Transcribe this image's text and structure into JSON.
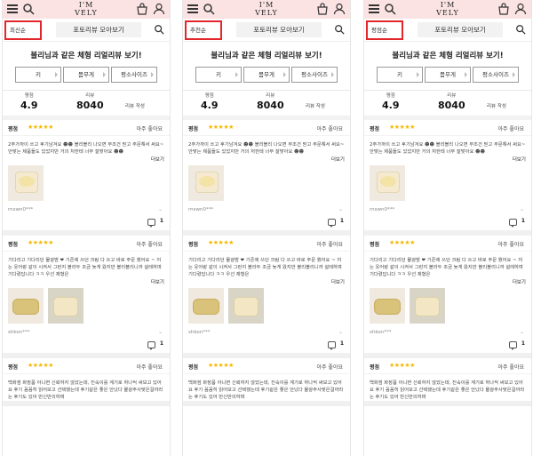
{
  "panels": [
    {
      "logo_line1": "I'M",
      "logo_line2": "VELY",
      "sort_label": "최신순",
      "photo_review_label": "포토리뷰 모아보기",
      "headline": "블리님과 같은 체형 리얼리뷰 보기!",
      "options": [
        "키",
        "몸무게",
        "평소사이즈"
      ],
      "stats": {
        "rating_label": "평점",
        "rating_value": "4.9",
        "review_label": "리뷰",
        "review_value": "8040",
        "write_label": "리뷰 작성"
      },
      "reviews": [
        {
          "label": "평점",
          "stars": "★★★★★",
          "like": "아주 좋아요",
          "text": "2주가까이 쓰고 후기남겨요 ☻☻ 블리블리 나오면 무조건 믿고 주문해서 써요~ 안맞는 제품들도 있었지만 거의 처한테 너무 잘맞아요 ☻☻",
          "more": "더보기",
          "author": "rnswn0***",
          "comments": "1"
        },
        {
          "label": "평점",
          "stars": "★★★★★",
          "like": "아주 좋아요",
          "text": "기다리고 기다리던 물광밤 ❤ 기존에 쓰던 크림 다 쓰고 바로 주문 했어요 ~ 저는 웃어랑 같이 시켜서 그런지 블라두 조금 늦게 왔지만 블리블리니까 설레하며 기다렸답니다 ㅋㅋ 우선 제형은",
          "more": "더보기",
          "author": "shkon***",
          "comments": "1"
        },
        {
          "label": "평점",
          "stars": "★★★★★",
          "like": "아주 좋아요",
          "text": "백화점 화장품 아니면 신뢰하지 않았는데, 진숙이를 계기로 하나씩 써보고 있어요 후기 꼼꼼히 읽어보고 선택했는데 후기같은 좋은 안났다 물광주사맞은걸까라는 후기도 있어 반신반의하며"
        }
      ]
    },
    {
      "logo_line1": "I'M",
      "logo_line2": "VELY",
      "sort_label": "추천순",
      "photo_review_label": "포토리뷰 모아보기",
      "headline": "블리님과 같은 체형 리얼리뷰 보기!",
      "options": [
        "키",
        "몸무게",
        "평소사이즈"
      ],
      "stats": {
        "rating_label": "평점",
        "rating_value": "4.9",
        "review_label": "리뷰",
        "review_value": "8040",
        "write_label": "리뷰 작성"
      },
      "reviews": [
        {
          "label": "평점",
          "stars": "★★★★★",
          "like": "아주 좋아요",
          "text": "2주가까이 쓰고 후기남겨요 ☻☻ 블리블리 나오면 무조건 믿고 주문해서 써요~ 안맞는 제품들도 있었지만 거의 처한테 너무 잘맞아요 ☻☻",
          "more": "더보기",
          "author": "rnswn0***",
          "comments": "1"
        },
        {
          "label": "평점",
          "stars": "★★★★★",
          "like": "아주 좋아요",
          "text": "기다리고 기다리던 물광밤 ❤ 기존에 쓰던 크림 다 쓰고 바로 주문 했어요 ~ 저는 웃어랑 같이 시켜서 그런지 블라두 조금 늦게 왔지만 블리블리니까 설레하며 기다렸답니다 ㅋㅋ 우선 제형은",
          "more": "더보기",
          "author": "shkon***",
          "comments": "1"
        },
        {
          "label": "평점",
          "stars": "★★★★★",
          "like": "아주 좋아요",
          "text": "백화점 화장품 아니면 신뢰하지 않았는데, 진숙이를 계기로 하나씩 써보고 있어요 후기 꼼꼼히 읽어보고 선택했는데 후기같은 좋은 안났다 물광주사맞은걸까라는 후기도 있어 반신반의하며"
        }
      ]
    },
    {
      "logo_line1": "I'M",
      "logo_line2": "VELY",
      "sort_label": "평점순",
      "photo_review_label": "포토리뷰 모아보기",
      "headline": "블리님과 같은 체형 리얼리뷰 보기!",
      "options": [
        "키",
        "몸무게",
        "평소사이즈"
      ],
      "stats": {
        "rating_label": "평점",
        "rating_value": "4.9",
        "review_label": "리뷰",
        "review_value": "8040",
        "write_label": "리뷰 작성"
      },
      "reviews": [
        {
          "label": "평점",
          "stars": "★★★★★",
          "like": "아주 좋아요",
          "text": "2주가까이 쓰고 후기남겨요 ☻☻ 블리블리 나오면 무조건 믿고 주문해서 써요~ 안맞는 제품들도 있었지만 거의 처한테 너무 잘맞아요 ☻☻",
          "more": "더보기",
          "author": "rnswn0***",
          "comments": "1"
        },
        {
          "label": "평점",
          "stars": "★★★★★",
          "like": "아주 좋아요",
          "text": "기다리고 기다리던 물광밤 ❤ 기존에 쓰던 크림 다 쓰고 바로 주문 했어요 ~ 저는 웃어랑 같이 시켜서 그런지 블라두 조금 늦게 왔지만 블리블리니까 설레하며 기다렸답니다 ㅋㅋ 우선 제형은",
          "more": "더보기",
          "author": "shkon***",
          "comments": "1"
        },
        {
          "label": "평점",
          "stars": "★★★★★",
          "like": "아주 좋아요",
          "text": "백화점 화장품 아니면 신뢰하지 않았는데, 진숙이를 계기로 하나씩 써보고 있어요 후기 꼼꼼히 읽어보고 선택했는데 후기같은 좋은 안났다 물광주사맞은걸까라는 후기도 있어 반신반의하며"
        }
      ]
    }
  ],
  "colors": {
    "topbar": "#fbe3e3",
    "highlight_box": "#e3262b",
    "stars": "#f5b800"
  },
  "icons": [
    "hamburger-menu-icon",
    "search-icon",
    "shopping-bag-icon",
    "user-icon",
    "comment-icon",
    "chevron-down-icon"
  ]
}
